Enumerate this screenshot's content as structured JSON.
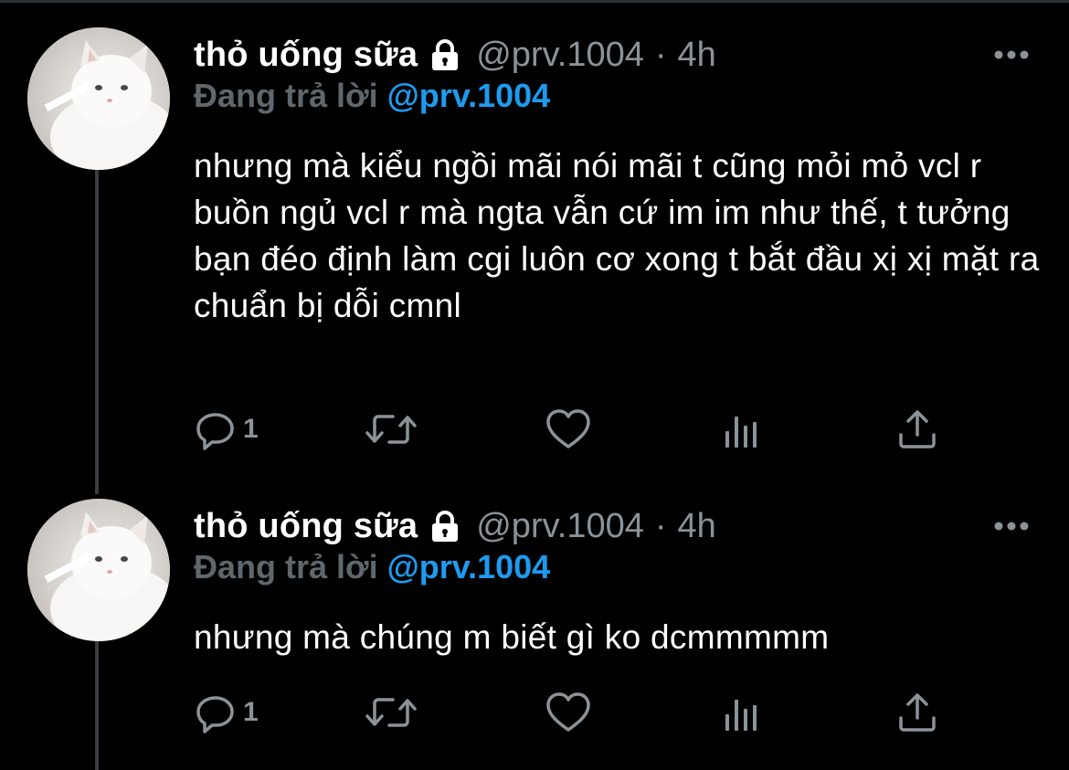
{
  "tweets": [
    {
      "display_name": "thỏ uống sữa",
      "handle": "@prv.1004",
      "separator": "·",
      "time": "4h",
      "reply_prefix": "Đang trả lời",
      "reply_to": "@prv.1004",
      "text": "nhưng mà kiểu ngồi mãi nói mãi t cũng mỏi mỏ vcl r buồn ngủ vcl r mà ngta vẫn cứ im im như thế, t tưởng bạn đéo định làm cgi luôn cơ xong t bắt đầu xị xị mặt ra chuẩn bị dỗi cmnl",
      "reply_count": "1"
    },
    {
      "display_name": "thỏ uống sữa",
      "handle": "@prv.1004",
      "separator": "·",
      "time": "4h",
      "reply_prefix": "Đang trả lời",
      "reply_to": "@prv.1004",
      "text": "nhưng mà chúng m biết gì ko dcmmmmm",
      "reply_count": "1"
    }
  ],
  "icons": {
    "lock": "lock-icon",
    "more": "more-icon",
    "reply": "reply-icon",
    "retweet": "retweet-icon",
    "like": "like-icon",
    "views": "views-icon",
    "share": "share-icon"
  },
  "colors": {
    "background": "#000000",
    "text": "#ffffff",
    "secondary": "#8b9399",
    "reply_prefix": "#5f676d",
    "accent": "#1d9bf0",
    "thread_line": "#3a3d40"
  }
}
